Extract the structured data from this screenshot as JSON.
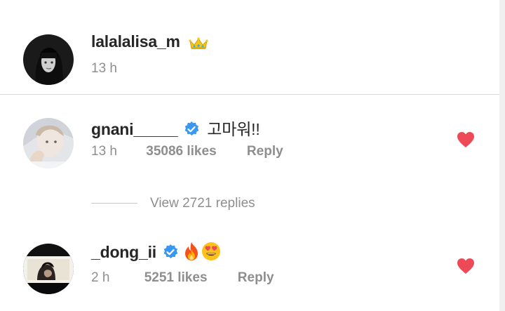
{
  "caption": {
    "username": "lalalalisa_m",
    "time": "13 h"
  },
  "comments": [
    {
      "username": "gnani_____",
      "verified": true,
      "text": "고마워!!",
      "time": "13 h",
      "likes": "35086 likes",
      "reply_label": "Reply",
      "liked": true
    },
    {
      "username": "_dong_ii",
      "verified": true,
      "text": "",
      "emojis": [
        "fire-emoji",
        "heart-eyes-emoji"
      ],
      "time": "2 h",
      "likes": "5251 likes",
      "reply_label": "Reply",
      "liked": true
    }
  ],
  "view_replies": "View 2721 replies",
  "colors": {
    "verified": "#3897f0",
    "heart": "#ed4956",
    "meta": "#8e8e8e",
    "text": "#262626"
  },
  "icons": {
    "crown": "crown-icon",
    "verified": "verified-badge-icon",
    "like": "heart-icon"
  }
}
